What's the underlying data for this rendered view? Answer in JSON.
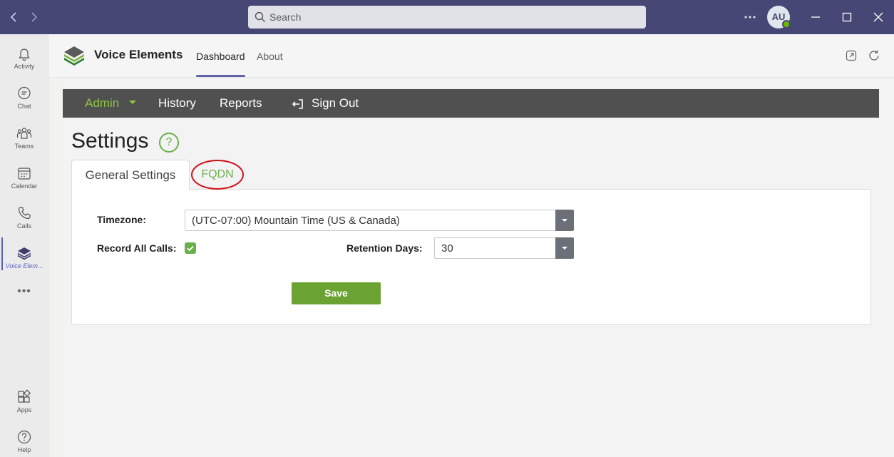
{
  "titlebar": {
    "search_placeholder": "Search",
    "avatar_initials": "AU"
  },
  "rail": {
    "items": [
      {
        "label": "Activity",
        "icon": "bell-icon"
      },
      {
        "label": "Chat",
        "icon": "chat-icon"
      },
      {
        "label": "Teams",
        "icon": "teams-icon"
      },
      {
        "label": "Calendar",
        "icon": "calendar-icon"
      },
      {
        "label": "Calls",
        "icon": "phone-icon"
      },
      {
        "label": "Voice Elem...",
        "icon": "layers-icon"
      },
      {
        "label": "Apps",
        "icon": "apps-icon"
      },
      {
        "label": "Help",
        "icon": "help-icon"
      }
    ],
    "more": "•••"
  },
  "app_header": {
    "title": "Voice Elements",
    "tabs": [
      {
        "label": "Dashboard",
        "active": true
      },
      {
        "label": "About",
        "active": false
      }
    ]
  },
  "admin_bar": {
    "admin": "Admin",
    "history": "History",
    "reports": "Reports",
    "sign_out": "Sign Out"
  },
  "settings": {
    "title": "Settings",
    "help_symbol": "?",
    "tabs": {
      "general": "General Settings",
      "fqdn": "FQDN"
    },
    "timezone_label": "Timezone:",
    "timezone_value": "(UTC-07:00) Mountain Time (US & Canada)",
    "record_label": "Record All Calls:",
    "record_checked": true,
    "retention_label": "Retention Days:",
    "retention_value": "30",
    "save_label": "Save"
  },
  "colors": {
    "titlebar": "#464775",
    "accent_green": "#6ab04c",
    "admin_bar": "#505050",
    "highlight_ellipse": "#d0101b"
  }
}
